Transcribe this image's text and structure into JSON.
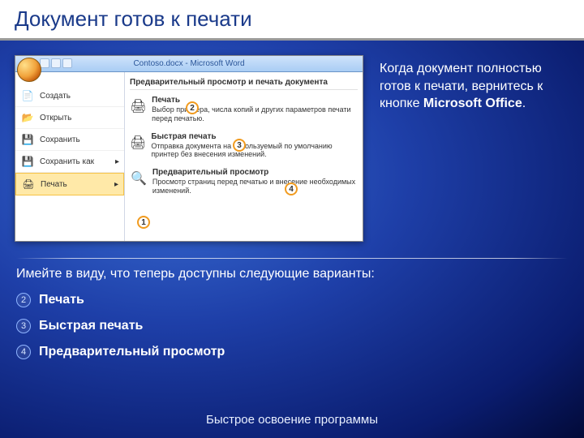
{
  "slide": {
    "title": "Документ готов к печати",
    "side_text_pre": "Когда документ полностью готов к печати, вернитесь к кнопке ",
    "side_text_bold": "Microsoft Office",
    "side_text_post": ".",
    "intro": "Имейте в виду, что теперь доступны следующие варианты:",
    "bullets": [
      {
        "num": "2",
        "label": "Печать"
      },
      {
        "num": "3",
        "label": "Быстрая печать"
      },
      {
        "num": "4",
        "label": "Предварительный просмотр"
      }
    ],
    "footer": "Быстрое освоение программы"
  },
  "screenshot": {
    "window_title": "Contoso.docx - Microsoft Word",
    "left_menu": [
      {
        "icon": "📄",
        "label": "Создать"
      },
      {
        "icon": "📂",
        "label": "Открыть"
      },
      {
        "icon": "💾",
        "label": "Сохранить"
      },
      {
        "icon": "💾",
        "label": "Сохранить как",
        "arrow": "▸"
      },
      {
        "icon": "🖨",
        "label": "Печать",
        "arrow": "▸",
        "highlight": true
      }
    ],
    "panel_title": "Предварительный просмотр и печать документа",
    "options": [
      {
        "icon": "🖨",
        "title": "Печать",
        "desc": "Выбор принтера, числа копий и других параметров печати перед печатью."
      },
      {
        "icon": "🖨",
        "title": "Быстрая печать",
        "desc": "Отправка документа на используемый по умолчанию принтер без внесения изменений."
      },
      {
        "icon": "🔍",
        "title": "Предварительный просмотр",
        "desc": "Просмотр страниц перед печатью и внесение необходимых изменений."
      }
    ],
    "callouts": {
      "c1": "1",
      "c2": "2",
      "c3": "3",
      "c4": "4"
    }
  }
}
